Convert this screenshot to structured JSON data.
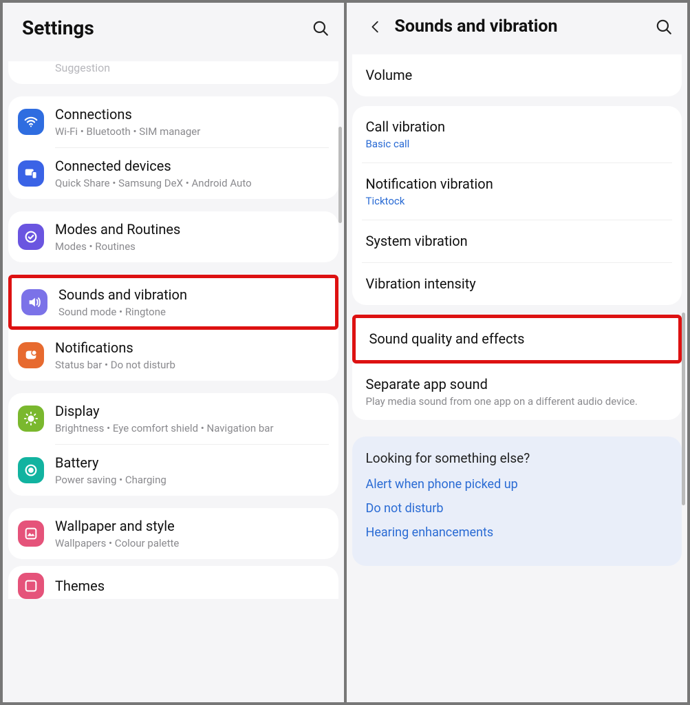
{
  "left": {
    "title": "Settings",
    "stub": "Suggestion",
    "cards": [
      [
        {
          "icon": "wifi",
          "bg": "#2f6de0",
          "title": "Connections",
          "sub": "Wi-Fi  •  Bluetooth  •  SIM manager"
        },
        {
          "icon": "devices",
          "bg": "#3a63e6",
          "title": "Connected devices",
          "sub": "Quick Share  •  Samsung DeX  •  Android Auto"
        }
      ],
      [
        {
          "icon": "modes",
          "bg": "#6a55e0",
          "title": "Modes and Routines",
          "sub": "Modes  •  Routines"
        },
        {
          "icon": "sound",
          "bg": "#7b72e8",
          "title": "Sounds and vibration",
          "sub": "Sound mode  •  Ringtone",
          "highlight": true
        },
        {
          "icon": "notif",
          "bg": "#e76a2f",
          "title": "Notifications",
          "sub": "Status bar  •  Do not disturb"
        }
      ],
      [
        {
          "icon": "sun",
          "bg": "#7ab82e",
          "title": "Display",
          "sub": "Brightness  •  Eye comfort shield  •  Navigation bar"
        },
        {
          "icon": "battery",
          "bg": "#12b3a0",
          "title": "Battery",
          "sub": "Power saving  •  Charging"
        }
      ],
      [
        {
          "icon": "wallpaper",
          "bg": "#e5537a",
          "title": "Wallpaper and style",
          "sub": "Wallpapers  •  Colour palette"
        }
      ]
    ],
    "themes": {
      "icon": "themes",
      "bg": "#e5537a",
      "title": "Themes"
    }
  },
  "right": {
    "title": "Sounds and vibration",
    "cards": [
      [
        {
          "title": "Volume"
        }
      ],
      [
        {
          "title": "Call vibration",
          "sub": "Basic call",
          "link": true
        },
        {
          "title": "Notification vibration",
          "sub": "Ticktock",
          "link": true
        },
        {
          "title": "System vibration"
        },
        {
          "title": "Vibration intensity"
        }
      ],
      [
        {
          "title": "Sound quality and effects",
          "highlight": true
        },
        {
          "title": "Separate app sound",
          "sub": "Play media sound from one app on a different audio device."
        }
      ]
    ],
    "info": {
      "title": "Looking for something else?",
      "links": [
        "Alert when phone picked up",
        "Do not disturb",
        "Hearing enhancements"
      ]
    }
  }
}
